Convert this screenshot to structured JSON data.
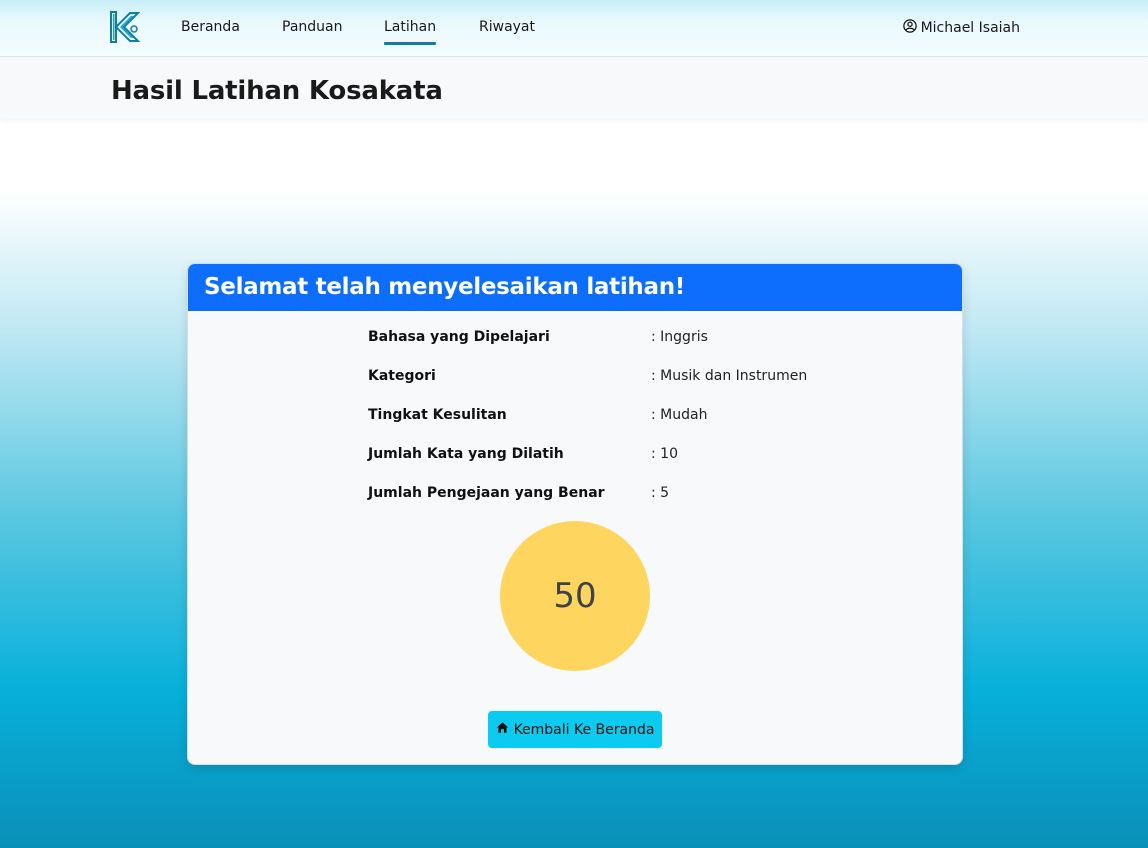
{
  "nav": {
    "logo_icon": "k-logo-icon",
    "links": [
      {
        "label": "Beranda"
      },
      {
        "label": "Panduan"
      },
      {
        "label": "Latihan",
        "active": true
      },
      {
        "label": "Riwayat"
      }
    ],
    "user": {
      "icon": "user-circle-icon",
      "name": "Michael Isaiah"
    }
  },
  "page": {
    "title": "Hasil Latihan Kosakata"
  },
  "result": {
    "header": "Selamat telah menyelesaikan latihan!",
    "rows": [
      {
        "label": "Bahasa yang Dipelajari",
        "value": ": Inggris"
      },
      {
        "label": "Kategori",
        "value": ": Musik dan Instrumen"
      },
      {
        "label": "Tingkat Kesulitan",
        "value": ": Mudah"
      },
      {
        "label": "Jumlah Kata yang Dilatih",
        "value": ": 10"
      },
      {
        "label": "Jumlah Pengejaan yang Benar",
        "value": ": 5"
      }
    ],
    "score": "50",
    "back_button": {
      "icon": "home-icon",
      "label": "Kembali Ke Beranda"
    }
  },
  "colors": {
    "card_header": "#0d6efd",
    "score_circle": "#fed55f",
    "button": "#0dcaf0",
    "nav_active": "#0e7fa0"
  }
}
